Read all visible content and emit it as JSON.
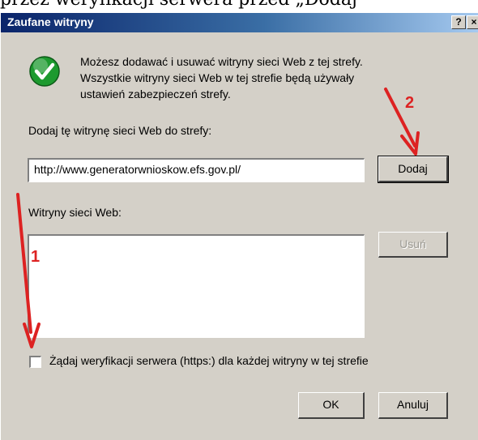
{
  "page": {
    "top_text": "przez weryfikacji serwera przed „Dodaj"
  },
  "dialog": {
    "title": "Zaufane witryny",
    "help_button": "?",
    "close_button": "×",
    "info_lines": [
      "Możesz dodawać i usuwać witryny sieci Web z tej strefy.",
      "Wszystkie witryny sieci Web w tej strefie będą używały",
      "ustawień zabezpieczeń strefy."
    ],
    "add_label": "Dodaj tę witrynę sieci Web do strefy:",
    "url_value": "http://www.generatorwnioskow.efs.gov.pl/",
    "add_button": "Dodaj",
    "sites_label": "Witryny sieci Web:",
    "sites": [],
    "remove_button": "Usuń",
    "https_checkbox_label": "Żądaj weryfikacji serwera (https:) dla każdej witryny w tej strefie",
    "https_checked": false,
    "ok_button": "OK",
    "cancel_button": "Anuluj"
  },
  "annotations": {
    "arrow_1_label": "1",
    "arrow_2_label": "2",
    "arrow_color": "#dd2222"
  },
  "icons": {
    "info": "green-checkmark-icon"
  }
}
